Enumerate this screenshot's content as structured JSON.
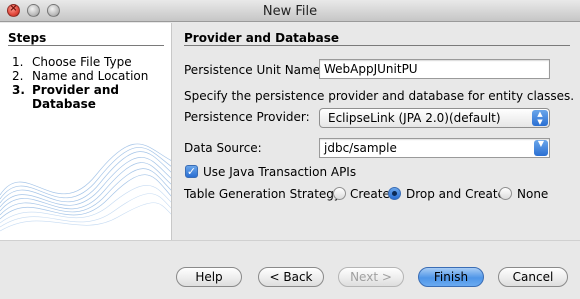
{
  "window": {
    "title": "New File"
  },
  "steps": {
    "title": "Steps",
    "items": [
      {
        "num": "1.",
        "label": "Choose File Type"
      },
      {
        "num": "2.",
        "label": "Name and Location"
      },
      {
        "num": "3.",
        "label": "Provider and Database"
      }
    ],
    "current_index": 2
  },
  "panel": {
    "title": "Provider and Database",
    "persistence_unit_name_label": "Persistence Unit Name:",
    "persistence_unit_name_value": "WebAppJUnitPU",
    "description": "Specify the persistence provider and database for entity classes.",
    "persistence_provider_label": "Persistence Provider:",
    "persistence_provider_value": "EclipseLink (JPA 2.0)(default)",
    "data_source_label": "Data Source:",
    "data_source_value": "jdbc/sample",
    "use_jta_label": "Use Java Transaction APIs",
    "use_jta_checked": true,
    "table_generation_label": "Table Generation Strategy:",
    "table_generation_options": [
      "Create",
      "Drop and Create",
      "None"
    ],
    "table_generation_selected": "Drop and Create"
  },
  "buttons": {
    "help": "Help",
    "back": "< Back",
    "next": "Next >",
    "finish": "Finish",
    "cancel": "Cancel"
  },
  "colors": {
    "accent": "#2a6fd3",
    "window_bg": "#e8e8e8"
  }
}
